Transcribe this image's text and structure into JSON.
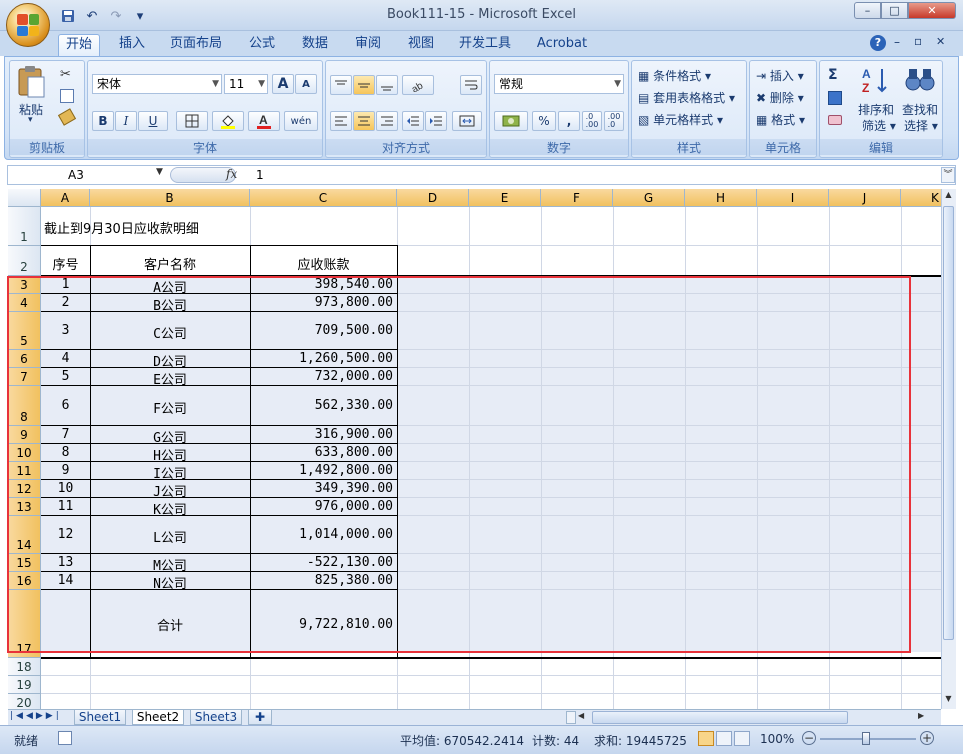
{
  "window": {
    "title": "Book111-15 - Microsoft Excel",
    "buttons": {
      "minimize": "–",
      "restore": "□",
      "close": "✕"
    }
  },
  "quick_access": {
    "save": "💾",
    "undo": "↶",
    "redo": "↷",
    "customize": "▾"
  },
  "tabs": [
    "开始",
    "插入",
    "页面布局",
    "公式",
    "数据",
    "审阅",
    "视图",
    "开发工具",
    "Acrobat"
  ],
  "ribbon_controls": {
    "help": "?",
    "min": "–",
    "restore": "▫",
    "close": "✕"
  },
  "ribbon": {
    "clipboard": {
      "label": "剪贴板",
      "paste": "粘贴"
    },
    "font": {
      "label": "字体",
      "name": "宋体",
      "size": "11",
      "bold": "B",
      "italic": "I",
      "underline": "U",
      "grow": "A",
      "shrink": "A",
      "phonetic": "wén"
    },
    "alignment": {
      "label": "对齐方式"
    },
    "number": {
      "label": "数字",
      "format": "常规",
      "percent": "%",
      "comma": ","
    },
    "styles": {
      "label": "样式",
      "conditional": "条件格式",
      "table": "套用表格格式",
      "cell": "单元格样式"
    },
    "cells": {
      "label": "单元格",
      "insert": "插入",
      "delete": "删除",
      "format": "格式"
    },
    "editing": {
      "label": "编辑",
      "sum": "Σ",
      "sort": "排序和",
      "filter": "筛选",
      "find": "查找和",
      "select": "选择"
    }
  },
  "formula_bar": {
    "name_box": "A3",
    "fx": "fx",
    "content": "1"
  },
  "columns": [
    "A",
    "B",
    "C",
    "D",
    "E",
    "F",
    "G",
    "H",
    "I",
    "J",
    "K"
  ],
  "rows": [
    "1",
    "2",
    "3",
    "4",
    "5",
    "6",
    "7",
    "8",
    "9",
    "10",
    "11",
    "12",
    "13",
    "14",
    "15",
    "16",
    "17",
    "18",
    "19",
    "20"
  ],
  "sheet": {
    "title": "截止到9月30日应收款明细",
    "headers": {
      "seq": "序号",
      "customer": "客户名称",
      "amount": "应收账款"
    },
    "data": [
      {
        "seq": "1",
        "customer": "A公司",
        "amount": "398,540.00"
      },
      {
        "seq": "2",
        "customer": "B公司",
        "amount": "973,800.00"
      },
      {
        "seq": "3",
        "customer": "C公司",
        "amount": "709,500.00"
      },
      {
        "seq": "4",
        "customer": "D公司",
        "amount": "1,260,500.00"
      },
      {
        "seq": "5",
        "customer": "E公司",
        "amount": "732,000.00"
      },
      {
        "seq": "6",
        "customer": "F公司",
        "amount": "562,330.00"
      },
      {
        "seq": "7",
        "customer": "G公司",
        "amount": "316,900.00"
      },
      {
        "seq": "8",
        "customer": "H公司",
        "amount": "633,800.00"
      },
      {
        "seq": "9",
        "customer": "I公司",
        "amount": "1,492,800.00"
      },
      {
        "seq": "10",
        "customer": "J公司",
        "amount": "349,390.00"
      },
      {
        "seq": "11",
        "customer": "K公司",
        "amount": "976,000.00"
      },
      {
        "seq": "12",
        "customer": "L公司",
        "amount": "1,014,000.00"
      },
      {
        "seq": "13",
        "customer": "M公司",
        "amount": "-522,130.00"
      },
      {
        "seq": "14",
        "customer": "N公司",
        "amount": "825,380.00"
      }
    ],
    "total_label": "合计",
    "total_amount": "9,722,810.00"
  },
  "sheet_tabs": [
    "Sheet1",
    "Sheet2",
    "Sheet3"
  ],
  "status": {
    "ready": "就绪",
    "average": "平均值: 670542.2414",
    "count": "计数: 44",
    "sum": "求和: 19445725",
    "zoom": "100%"
  },
  "colors": {
    "highlight": "#e8323a",
    "selection": "#e7ecf6",
    "header_selected": "#f1c15f"
  }
}
